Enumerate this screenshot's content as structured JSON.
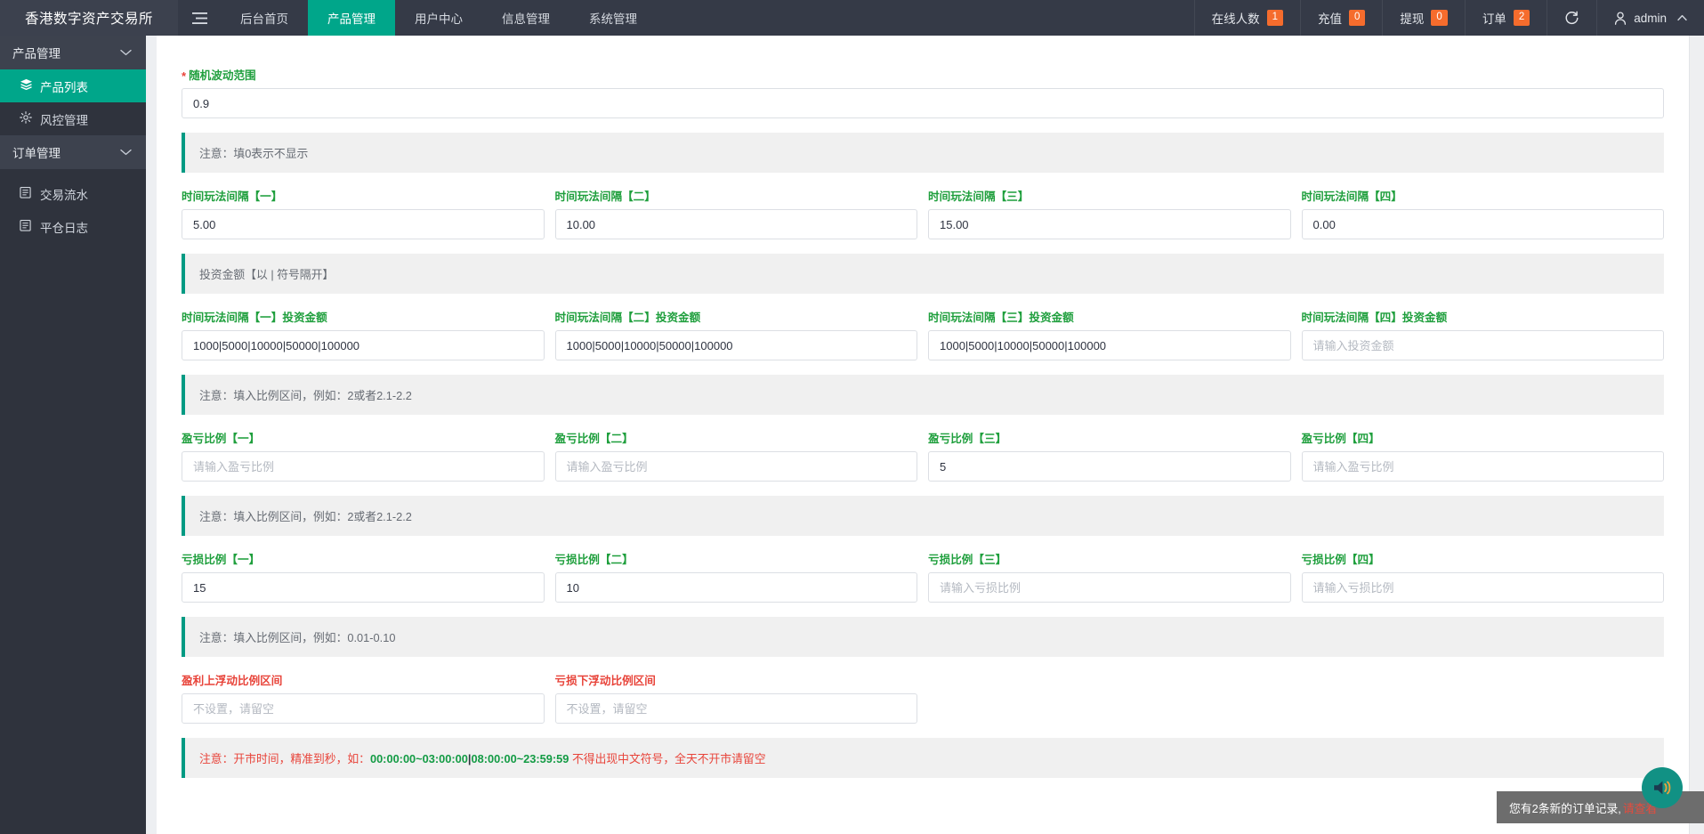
{
  "navbar": {
    "brand": "香港数字资产交易所",
    "menu_icon": "hamburger-icon",
    "items": [
      {
        "label": "后台首页",
        "active": false
      },
      {
        "label": "产品管理",
        "active": true
      },
      {
        "label": "用户中心",
        "active": false
      },
      {
        "label": "信息管理",
        "active": false
      },
      {
        "label": "系统管理",
        "active": false
      }
    ],
    "stats": [
      {
        "label": "在线人数",
        "count": "1"
      },
      {
        "label": "充值",
        "count": "0"
      },
      {
        "label": "提现",
        "count": "0"
      },
      {
        "label": "订单",
        "count": "2"
      }
    ],
    "refresh_icon": "↻",
    "user": "admin",
    "user_caret": "⌃",
    "person_icon": "⚲"
  },
  "sidebar": {
    "groups": [
      {
        "label": "产品管理",
        "chevron": "⌄",
        "items": [
          {
            "label": "产品列表",
            "icon": "layers-icon",
            "glyph": "▤",
            "active": true
          },
          {
            "label": "风控管理",
            "icon": "gear-icon",
            "glyph": "⚙",
            "active": false
          }
        ]
      },
      {
        "label": "订单管理",
        "chevron": "⌄",
        "items": [
          {
            "label": "交易流水",
            "icon": "clipboard-icon",
            "glyph": "▤",
            "active": false
          },
          {
            "label": "平仓日志",
            "icon": "clipboard-icon",
            "glyph": "▤",
            "active": false
          }
        ]
      }
    ]
  },
  "form": {
    "random_range": {
      "label": "随机波动范围",
      "required_mark": "*",
      "value": "0.9"
    },
    "notice_1": "注意：填0表示不显示",
    "time_intervals": {
      "labels": [
        "时间玩法间隔【一】",
        "时间玩法间隔【二】",
        "时间玩法间隔【三】",
        "时间玩法间隔【四】"
      ],
      "values": [
        "5.00",
        "10.00",
        "15.00",
        "0.00"
      ],
      "placeholders": [
        "",
        "",
        "",
        ""
      ]
    },
    "notice_2": "投资金额【以 | 符号隔开】",
    "invest_amounts": {
      "labels": [
        "时间玩法间隔【一】投资金额",
        "时间玩法间隔【二】投资金额",
        "时间玩法间隔【三】投资金额",
        "时间玩法间隔【四】投资金额"
      ],
      "values": [
        "1000|5000|10000|50000|100000",
        "1000|5000|10000|50000|100000",
        "1000|5000|10000|50000|100000",
        ""
      ],
      "placeholders": [
        "",
        "",
        "",
        "请输入投资金额"
      ]
    },
    "notice_3": "注意：填入比例区间，例如：2或者2.1-2.2",
    "profit_ratio": {
      "labels": [
        "盈亏比例【一】",
        "盈亏比例【二】",
        "盈亏比例【三】",
        "盈亏比例【四】"
      ],
      "values": [
        "",
        "",
        "5",
        ""
      ],
      "placeholders": [
        "请输入盈亏比例",
        "请输入盈亏比例",
        "",
        "请输入盈亏比例"
      ]
    },
    "notice_4": "注意：填入比例区间，例如：2或者2.1-2.2",
    "loss_ratio": {
      "labels": [
        "亏损比例【一】",
        "亏损比例【二】",
        "亏损比例【三】",
        "亏损比例【四】"
      ],
      "values": [
        "15",
        "10",
        "",
        ""
      ],
      "placeholders": [
        "",
        "",
        "请输入亏损比例",
        "请输入亏损比例"
      ]
    },
    "notice_5": "注意：填入比例区间，例如：0.01-0.10",
    "float_ratio": {
      "labels": [
        "盈利上浮动比例区间",
        "亏损下浮动比例区间"
      ],
      "values": [
        "",
        ""
      ],
      "placeholders": [
        "不设置，请留空",
        "不设置，请留空"
      ]
    },
    "notice_6": {
      "prefix": "注意：开市时间，精准到秒，如：",
      "time_a": "00:00:00~03:00:00",
      "separator": "|",
      "time_b": "08:00:00~23:59:59",
      "suffix": " 不得出现中文符号，全天不开市请留空"
    }
  },
  "toast": {
    "text": "您有2条新的订单记录,",
    "link": "请查看"
  },
  "sound_button": {
    "icon": "speaker-icon"
  },
  "colors": {
    "accent": "#00a68a",
    "navbar_bg": "#353a47",
    "sidebar_bg": "#2f333d",
    "label_green": "#1f9f3d",
    "label_red": "#e8443a",
    "badge_orange": "#f56c2d"
  }
}
